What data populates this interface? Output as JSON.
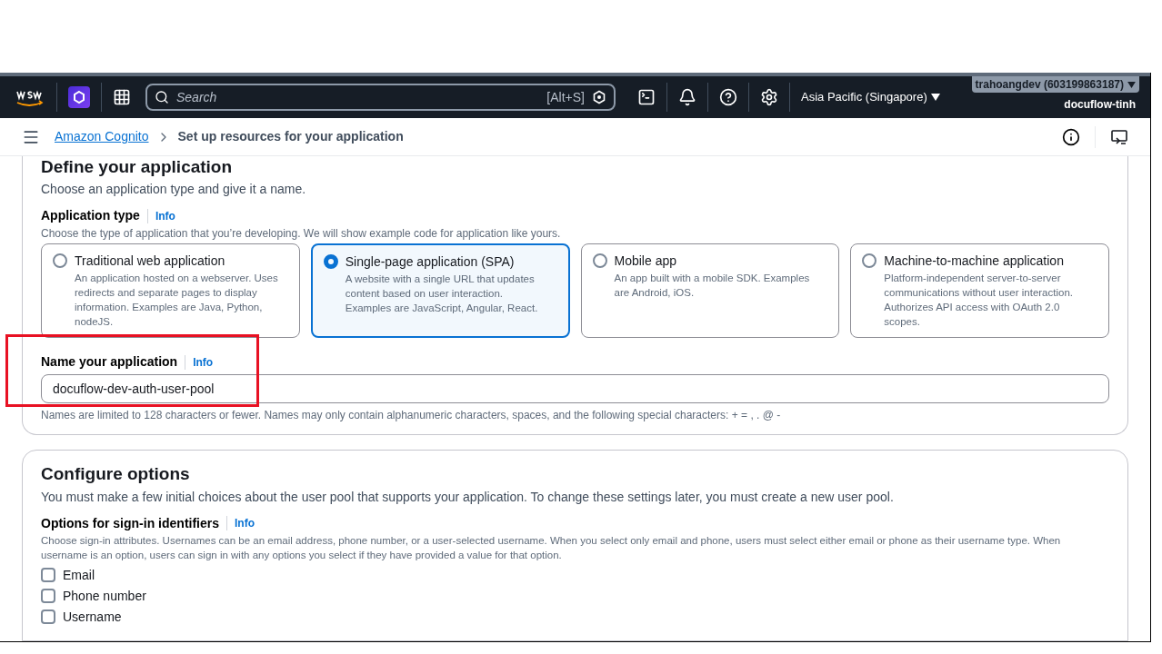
{
  "top_nav": {
    "search": {
      "placeholder": "Search",
      "shortcut": "[Alt+S]"
    },
    "region": "Asia Pacific (Singapore)",
    "account": "trahoangdev (603199863187)",
    "role": "docuflow-tinh"
  },
  "breadcrumb": {
    "items": [
      {
        "label": "Amazon Cognito",
        "kind": "link"
      },
      {
        "label": "Set up resources for your application",
        "kind": "current"
      }
    ]
  },
  "define_section": {
    "title": "Define your application",
    "description": "Choose an application type and give it a name.",
    "application_type": {
      "label": "Application type",
      "info": "Info",
      "description": "Choose the type of application that you’re developing. We will show example code for application like yours.",
      "options": [
        {
          "title": "Traditional web application",
          "description": "An application hosted on a webserver. Uses redirects and separate pages to display information. Examples are Java, Python, nodeJS.",
          "selected": false
        },
        {
          "title": "Single-page application (SPA)",
          "description": "A website with a single URL that updates content based on user interaction. Examples are JavaScript, Angular, React.",
          "selected": true
        },
        {
          "title": "Mobile app",
          "description": "An app built with a mobile SDK. Examples are Android, iOS.",
          "selected": false
        },
        {
          "title": "Machine-to-machine application",
          "description": "Platform-independent server-to-server communications without user interaction. Authorizes API access with OAuth 2.0 scopes.",
          "selected": false
        }
      ]
    },
    "name_field": {
      "label": "Name your application",
      "info": "Info",
      "value": "docuflow-dev-auth-user-pool",
      "hint": "Names are limited to 128 characters or fewer. Names may only contain alphanumeric characters, spaces, and the following special characters: + = , . @ -"
    }
  },
  "configure_section": {
    "title": "Configure options",
    "description": "You must make a few initial choices about the user pool that supports your application. To change these settings later, you must create a new user pool.",
    "sign_in_identifiers": {
      "label": "Options for sign-in identifiers",
      "info": "Info",
      "description": "Choose sign-in attributes. Usernames can be an email address, phone number, or a user-selected username. When you select only email and phone, users must select either email or phone as their username type. When username is an option, users can sign in with any options you select if they have provided a value for that option.",
      "options": [
        {
          "label": "Email",
          "checked": false
        },
        {
          "label": "Phone number",
          "checked": false
        },
        {
          "label": "Username",
          "checked": false
        }
      ]
    }
  }
}
